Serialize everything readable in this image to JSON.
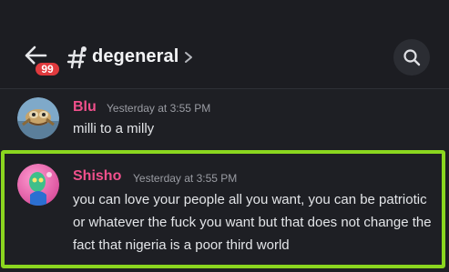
{
  "header": {
    "unread_badge": "99",
    "channel_name": "degeneral",
    "icons": {
      "back": "arrow-left-icon",
      "channel": "text-channel-hash-icon",
      "chevron": "chevron-right-icon",
      "search": "search-icon"
    }
  },
  "messages": [
    {
      "username": "Blu",
      "timestamp": "Yesterday at 3:55 PM",
      "text": "milli to a milly",
      "username_color": "#f0508c"
    },
    {
      "username": "Shisho",
      "timestamp": "Yesterday at 3:55 PM",
      "text": "you can love your people all you want, you can be patriotic or whatever the fuck you want but that does not change the fact that nigeria is a poor third world",
      "username_color": "#f0508c",
      "highlight_color": "#8bd61f"
    }
  ],
  "colors": {
    "background": "#1e1f24",
    "badge": "#e03a3e",
    "highlight": "#8bd61f"
  }
}
